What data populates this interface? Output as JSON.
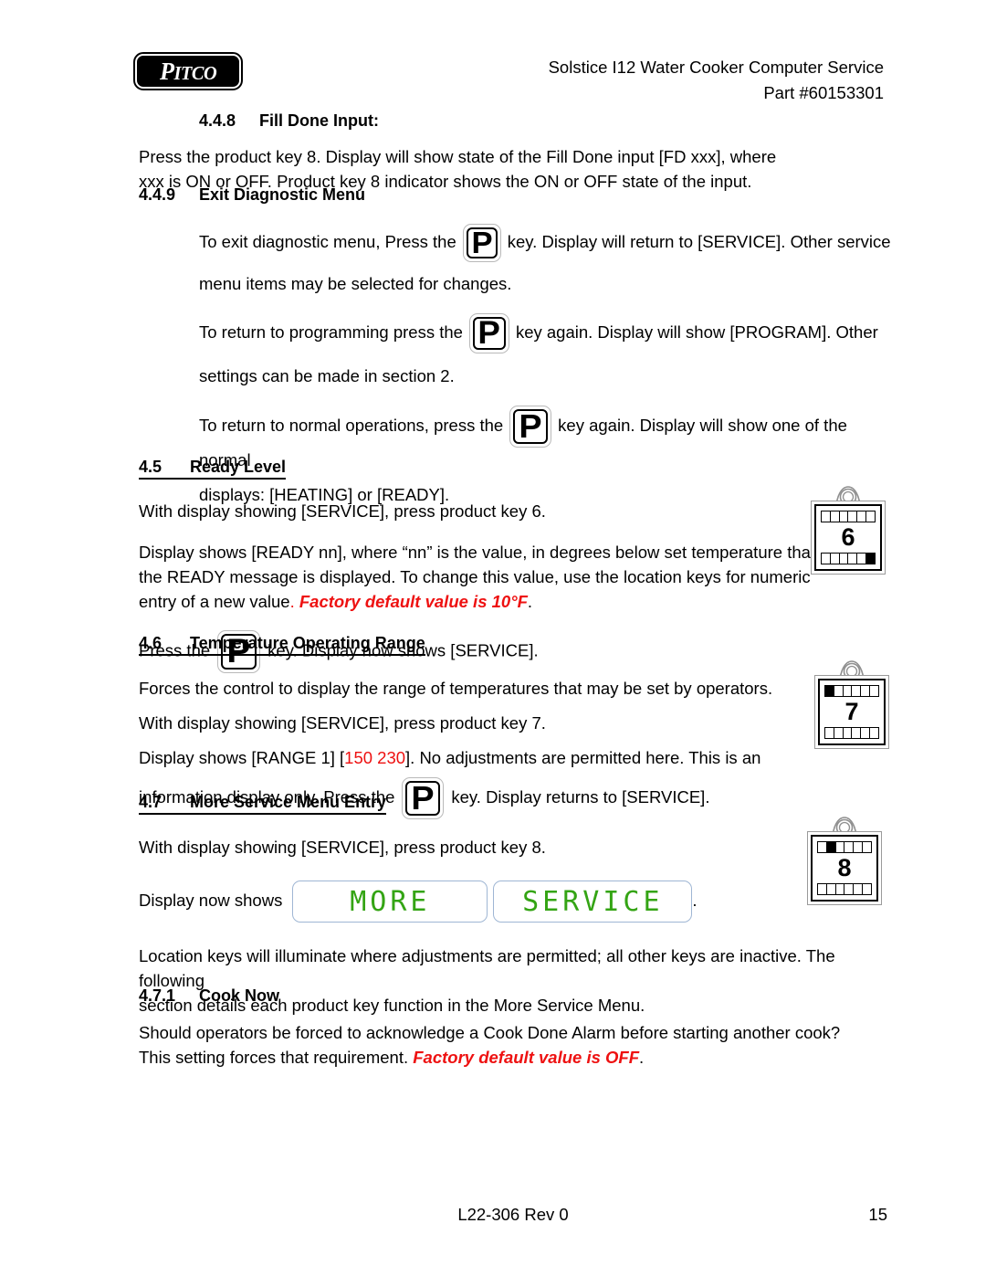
{
  "header": {
    "logo_text": "PITCO",
    "title": "Solstice I12 Water Cooker Computer Service",
    "part": "Part #60153301"
  },
  "sections": {
    "s448": {
      "number": "4.4.8",
      "title": "Fill Done Input:",
      "body_line1": "Press the product key 8. Display will show state of the Fill Done input [FD xxx], where",
      "body_line2": "xxx is ON or OFF.  Product key 8 indicator shows the ON or OFF state of the input."
    },
    "s449": {
      "number": "4.4.9",
      "title": "Exit Diagnostic Menu",
      "p1_a": "To exit diagnostic menu, Press the",
      "p1_b": "key.  Display will return to [SERVICE].  Other service",
      "p1_c": "menu items may be selected for changes.",
      "p2_a": "To return to programming press the",
      "p2_b": "key again.  Display will show [PROGRAM].  Other",
      "p2_c": "settings can be made in section 2.",
      "p3_a": "To return to normal operations, press the",
      "p3_b": "key again. Display will show one of the normal",
      "p3_c": "displays: [HEATING] or [READY]."
    },
    "s45": {
      "number": "4.5",
      "title": "Ready Level",
      "p1": "With display showing [SERVICE], press product key 6.",
      "p2_line1": "Display shows [READY nn], where “nn” is the value, in degrees below set temperature that",
      "p2_line2": "the READY message is displayed. To change this value, use the location keys for numeric",
      "p2_line3_a": "entry of a new value",
      "p2_line3_red_dot": ".",
      "p2_line3_red": "Factory default value is 10°F",
      "p2_line3_end": ".",
      "p3_a": "Press the",
      "p3_b": "key. Display now shows [SERVICE]."
    },
    "s46": {
      "number": "4.6",
      "title": "Temperature Operating Range",
      "p1": "Forces the control to display the range of temperatures that may be set by operators.",
      "p2": "With display showing [SERVICE], press product key 7.",
      "p3_a": "Display shows [RANGE 1] [",
      "p3_red": "150  230",
      "p3_b": "].  No adjustments are permitted here. This is an",
      "p4_a": "information display only. Press the",
      "p4_b": "key. Display returns to [SERVICE]."
    },
    "s47": {
      "number": "4.7",
      "title": "More Service Menu Entry",
      "p1": "With display showing [SERVICE], press product key 8.",
      "p2_a": "Display now shows",
      "p2_end": ".",
      "p3_line1": "Location keys will illuminate where adjustments are permitted; all other keys are inactive.  The following",
      "p3_line2": "section details each product key function in the More Service Menu."
    },
    "s471": {
      "number": "4.7.1",
      "title": "Cook Now",
      "body_line1": "Should operators be forced to acknowledge a Cook Done Alarm before starting another cook?",
      "body_line2_a": "This setting forces that requirement.",
      "body_line2_red": "Factory default value is OFF",
      "body_line2_end": "."
    }
  },
  "displays": {
    "more": "MORE",
    "service": "SERVICE"
  },
  "pkey_glyph": "P",
  "product_keys": {
    "key6": {
      "digit": "6",
      "top_on_index": -1,
      "bottom_on_index": 5
    },
    "key7": {
      "digit": "7",
      "top_on_index": 0,
      "bottom_on_index": -1
    },
    "key8": {
      "digit": "8",
      "top_on_index": 1,
      "bottom_on_index": -1
    }
  },
  "footer": {
    "doc": "L22-306 Rev 0",
    "page": "15"
  },
  "colors": {
    "red": "#ee1111",
    "led_green": "#34a414",
    "led_border": "#9fb6d4"
  }
}
